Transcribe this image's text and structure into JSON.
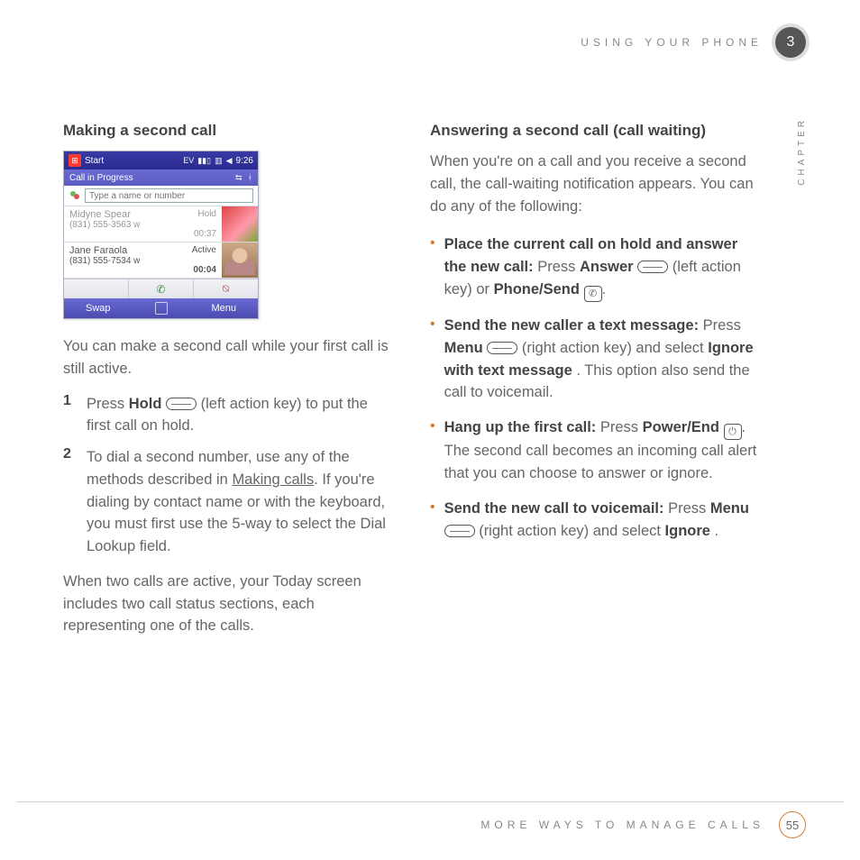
{
  "header": {
    "section": "USING YOUR PHONE",
    "chapter_num": "3",
    "chapter_label": "CHAPTER"
  },
  "footer": {
    "section": "MORE WAYS TO MANAGE CALLS",
    "page": "55"
  },
  "left": {
    "heading": "Making a second call",
    "intro": "You can make a second call while your first call is still active.",
    "steps": [
      {
        "n": "1",
        "pre": "Press ",
        "bold": "Hold",
        "post": " (left action key) to put the first call on hold."
      },
      {
        "n": "2",
        "pre": "To dial a second number, use any of the methods described in ",
        "link": "Making calls",
        "post": ". If you're dialing by contact name or with the keyboard, you must first use the 5-way to select the Dial Lookup field."
      }
    ],
    "outro": "When two calls are active, your Today screen includes two call status sections, each representing one of the calls."
  },
  "right": {
    "heading": "Answering a second call (call waiting)",
    "intro": "When you're on a call and you receive a second call, the call-waiting notification appears. You can do any of the following:",
    "items": [
      {
        "bold1": "Place the current call on hold and answer the new call:",
        "t1": " Press ",
        "bold2": "Answer",
        "t2": " (left action key) or ",
        "bold3": "Phone/Send",
        "t3": ".",
        "icon1": "oval",
        "icon2": "phone"
      },
      {
        "bold1": "Send the new caller a text message:",
        "t1": " Press ",
        "bold2": "Menu",
        "t2": " (right action key) and select ",
        "bold3": "Ignore with text message",
        "t3": ". This option also send the call to voicemail.",
        "icon1": "oval"
      },
      {
        "bold1": "Hang up the first call:",
        "t1": " Press ",
        "bold2": "Power/End",
        "t2": ". The second call becomes an incoming call alert that you can choose to answer or ignore.",
        "icon1": "end"
      },
      {
        "bold1": "Send the new call to voicemail:",
        "t1": " Press ",
        "bold2": "Menu",
        "t2": " (right action key) and select ",
        "bold3": "Ignore",
        "t3": ".",
        "icon1": "oval"
      }
    ]
  },
  "phone": {
    "start": "Start",
    "time": "9:26",
    "sub": "Call in Progress",
    "input_placeholder": "Type a name or number",
    "calls": [
      {
        "name": "Midyne Spear",
        "num": "(831) 555-3563 w",
        "status": "Hold",
        "timer": "00:37"
      },
      {
        "name": "Jane Faraola",
        "num": "(831) 555-7534 w",
        "status": "Active",
        "timer": "00:04"
      }
    ],
    "soft_left": "Swap",
    "soft_right": "Menu"
  }
}
